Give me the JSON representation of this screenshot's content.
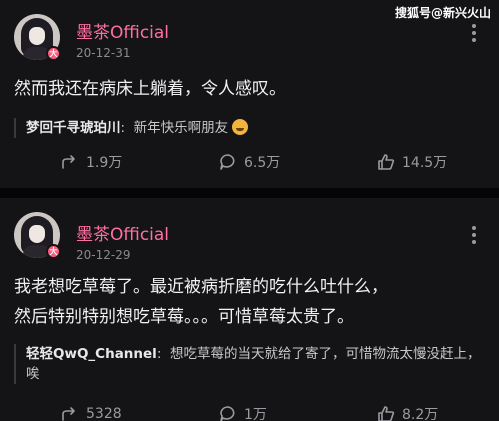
{
  "watermark": "搜狐号@新兴火山",
  "posts": [
    {
      "author": "墨茶Official",
      "date": "20-12-31",
      "badge": "大",
      "content": "然而我还在病床上躺着，令人感叹。",
      "repost_user": "梦回千寻琥珀川",
      "repost_text": "新年快乐啊朋友",
      "actions": {
        "share": "1.9万",
        "comment": "6.5万",
        "like": "14.5万"
      }
    },
    {
      "author": "墨茶Official",
      "date": "20-12-29",
      "badge": "大",
      "content": "我老想吃草莓了。最近被病折磨的吃什么吐什么，\n然后特别特别想吃草莓。。。可惜草莓太贵了。",
      "repost_user": "轻轻QwQ_Channel",
      "repost_text": "想吃草莓的当天就给了寄了，可惜物流太慢没赶上，唉",
      "actions": {
        "share": "5328",
        "comment": "1万",
        "like": "8.2万"
      }
    }
  ],
  "colors": {
    "author": "#ff6fa0",
    "background": "#141416",
    "badge": "#ff5a7a"
  },
  "icons": [
    "share-icon",
    "comment-icon",
    "like-icon",
    "more-icon",
    "emoji-icon"
  ]
}
